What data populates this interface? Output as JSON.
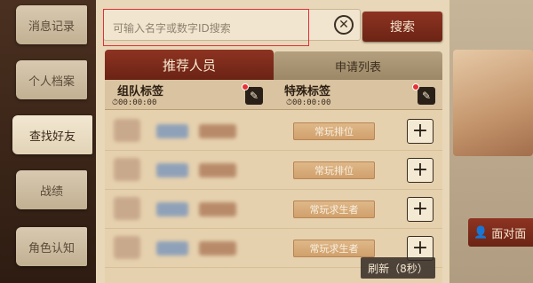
{
  "sidebar": {
    "items": [
      {
        "label": "消息记录",
        "active": false
      },
      {
        "label": "个人档案",
        "active": false
      },
      {
        "label": "查找好友",
        "active": true
      },
      {
        "label": "战绩",
        "active": false
      },
      {
        "label": "角色认知",
        "active": false
      }
    ]
  },
  "search": {
    "placeholder": "可输入名字或数字ID搜索",
    "button_label": "搜索",
    "clear_icon": "close-circle-icon"
  },
  "tabs": [
    {
      "label": "推荐人员",
      "active": true
    },
    {
      "label": "申请列表",
      "active": false
    }
  ],
  "tags": {
    "team_tag": {
      "title": "组队标签",
      "time": "00:00:00"
    },
    "special_tag": {
      "title": "特殊标签",
      "time": "00:00:00"
    }
  },
  "rows": [
    {
      "role": "常玩排位"
    },
    {
      "role": "常玩排位"
    },
    {
      "role": "常玩求生者"
    },
    {
      "role": "常玩求生者"
    }
  ],
  "refresh_label": "刷新（8秒）",
  "face_to_face_label": "面对面",
  "colors": {
    "accent": "#8e3322",
    "highlight_border": "#e0303a",
    "panel": "#e8d7b8"
  }
}
